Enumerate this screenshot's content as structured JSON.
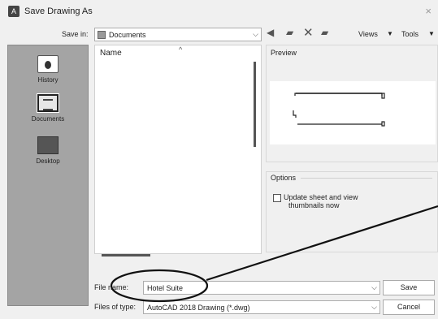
{
  "window": {
    "title": "Save Drawing As",
    "close_glyph": "×"
  },
  "toolbar": {
    "save_in_label": "Save in:",
    "save_in_value": "Documents",
    "views_label": "Views",
    "tools_label": "Tools",
    "icons": [
      "back-arrow-icon",
      "up-folder-icon",
      "delete-icon",
      "new-folder-icon"
    ]
  },
  "places": [
    {
      "label": "History"
    },
    {
      "label": "Documents"
    },
    {
      "label": "Desktop"
    }
  ],
  "file_list": {
    "column_name": "Name"
  },
  "preview": {
    "label": "Preview"
  },
  "options": {
    "label": "Options",
    "checkbox_label_line1": "Update sheet and view",
    "checkbox_label_line2": "thumbnails now",
    "checkbox_checked": false
  },
  "fields": {
    "file_name_label": "File name:",
    "file_name_value": "Hotel Suite",
    "file_type_label": "Files of type:",
    "file_type_value": "AutoCAD 2018 Drawing (*.dwg)"
  },
  "buttons": {
    "save": "Save",
    "cancel": "Cancel"
  },
  "colors": {
    "annotation": "#111111",
    "places_bg": "#a4a4a4"
  }
}
